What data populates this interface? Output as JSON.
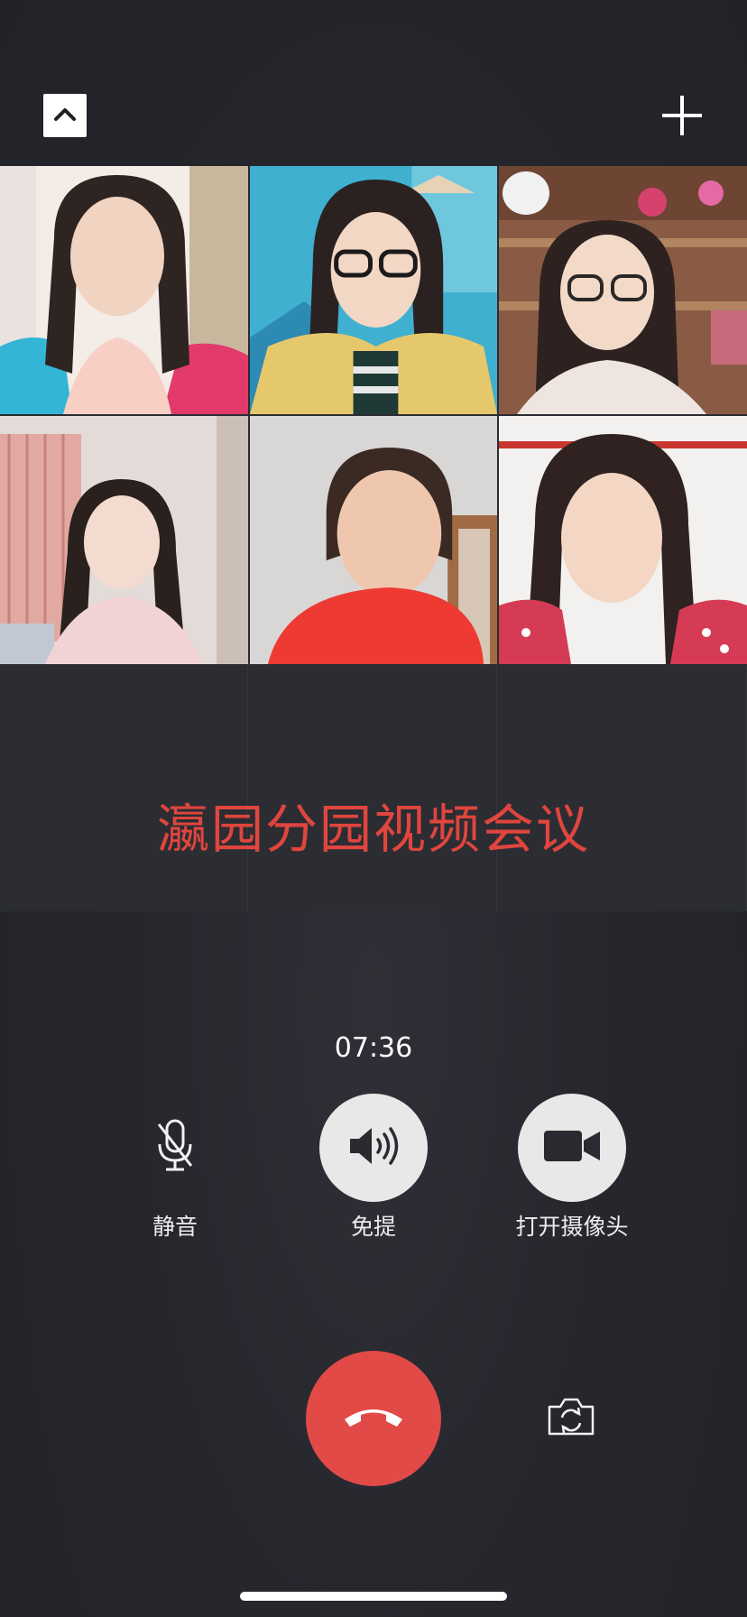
{
  "header": {
    "collapse_icon": "chevron-up-icon",
    "add_icon": "plus-icon"
  },
  "grid": {
    "participants": [
      {
        "name": ""
      },
      {
        "name": ""
      },
      {
        "name": ""
      },
      {
        "name": ""
      },
      {
        "name": ""
      },
      {
        "name": ""
      }
    ],
    "empty_slots": 3
  },
  "overlay": {
    "caption": "瀛园分园视频会议",
    "color": "#e0453e"
  },
  "call": {
    "duration": "07:36"
  },
  "controls": {
    "mute": {
      "label": "静音",
      "icon": "microphone-icon"
    },
    "speaker": {
      "label": "免提",
      "icon": "speaker-icon"
    },
    "camera": {
      "label": "打开摄像头",
      "icon": "video-camera-icon"
    },
    "hangup": {
      "icon": "hang-up-icon",
      "color": "#e24a48"
    },
    "flip": {
      "icon": "switch-camera-icon"
    }
  }
}
